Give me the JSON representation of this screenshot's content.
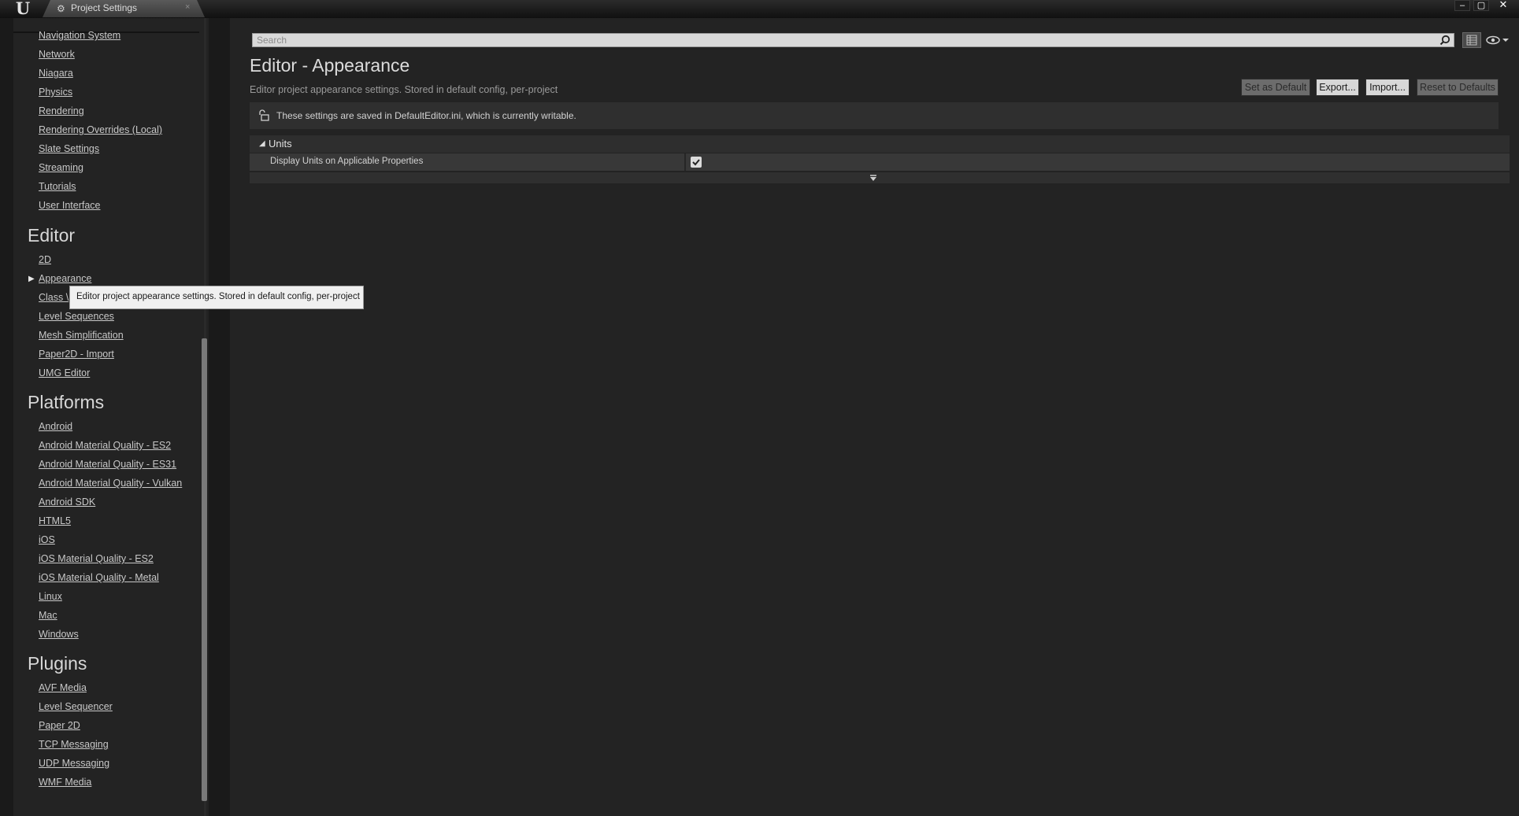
{
  "window": {
    "logo_text": "U",
    "tab_icon": "gear-icon",
    "tab_title": "Project Settings",
    "tab_close": "×",
    "controls": {
      "minimize": "–",
      "maximize": "▢",
      "close": "✕"
    }
  },
  "sidebar": {
    "items_top": [
      "Navigation System",
      "Network",
      "Niagara",
      "Physics",
      "Rendering",
      "Rendering Overrides (Local)",
      "Slate Settings",
      "Streaming",
      "Tutorials",
      "User Interface"
    ],
    "editor": {
      "header": "Editor",
      "items": [
        "2D",
        "Appearance",
        "Class \\",
        "Level Sequences",
        "Mesh Simplification",
        "Paper2D - Import",
        "UMG Editor"
      ],
      "selected": "Appearance"
    },
    "platforms": {
      "header": "Platforms",
      "items": [
        "Android",
        "Android Material Quality - ES2",
        "Android Material Quality - ES31",
        "Android Material Quality - Vulkan",
        "Android SDK",
        "HTML5",
        "iOS",
        "iOS Material Quality - ES2",
        "iOS Material Quality - Metal",
        "Linux",
        "Mac",
        "Windows"
      ]
    },
    "plugins": {
      "header": "Plugins",
      "items": [
        "AVF Media",
        "Level Sequencer",
        "Paper 2D",
        "TCP Messaging",
        "UDP Messaging",
        "WMF Media"
      ]
    }
  },
  "tooltip": {
    "text": "Editor project appearance settings. Stored in default config, per-project"
  },
  "main": {
    "search": {
      "placeholder": "Search"
    },
    "title": "Editor - Appearance",
    "subtitle": "Editor project appearance settings. Stored in default config, per-project",
    "buttons": {
      "set_default": "Set as Default",
      "export": "Export...",
      "import": "Import...",
      "reset": "Reset to Defaults"
    },
    "info_text": "These settings are saved in DefaultEditor.ini, which is currently writable.",
    "category": {
      "name": "Units",
      "properties": [
        {
          "label": "Display Units on Applicable Properties",
          "checked": true
        }
      ]
    }
  },
  "colors": {
    "background": "#1a1a1a",
    "panel": "#232323",
    "text": "#c8c8c8",
    "tooltip_bg": "#f0f0f0"
  }
}
